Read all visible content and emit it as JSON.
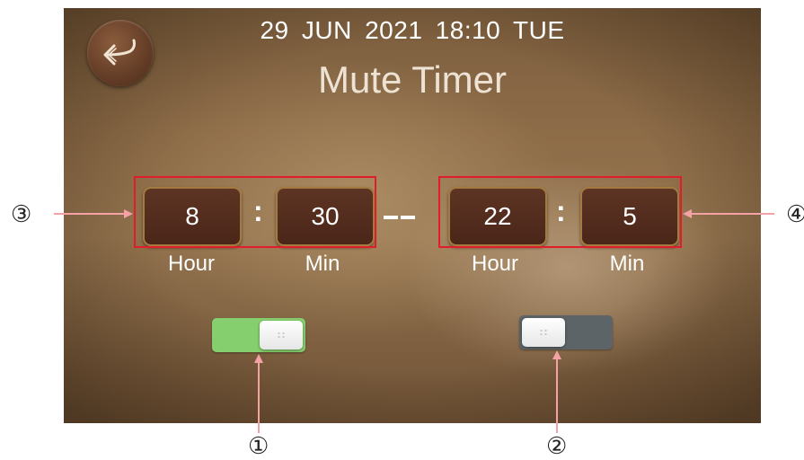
{
  "header": {
    "datetime": "29  JUN 2021  18:10  TUE",
    "title": "Mute Timer",
    "back_icon": "return-arrow-icon"
  },
  "start_time": {
    "hour": "8",
    "minute": "30",
    "hour_label": "Hour",
    "min_label": "Min"
  },
  "end_time": {
    "hour": "22",
    "minute": "5",
    "hour_label": "Hour",
    "min_label": "Min"
  },
  "separator": ":",
  "toggles": [
    {
      "state": "on",
      "color": "#86cf6e"
    },
    {
      "state": "off",
      "color": "#5d6468"
    }
  ],
  "callouts": {
    "c1": "①",
    "c2": "②",
    "c3": "③",
    "c4": "④"
  },
  "colors": {
    "highlight_box": "#e11d2a",
    "arrow": "#f4a2a6"
  }
}
